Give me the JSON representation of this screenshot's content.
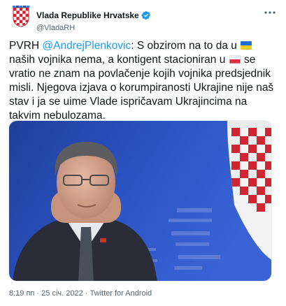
{
  "account": {
    "display_name": "Vlada Republike Hrvatske",
    "handle": "@VladaRH",
    "verified": true,
    "avatar_icon": "croatian-coat-of-arms-icon"
  },
  "tweet": {
    "text_before_mention": "PVRH ",
    "mention": "@AndrejPlenkovic",
    "text_1": ": S obzirom na to da u ",
    "text_2": " naših vojnika nema, a kontigent stacioniran u ",
    "text_3": " se vratio ne znam na povlačenje kojih vojnika predsjednik misli. Njegova izjava o korumpiranosti Ukrajine nije naš stav i ja se uime Vlade ispričavam Ukrajincima na takvim nebulozama.",
    "flag_1": "ukraine-flag-icon",
    "flag_2": "poland-flag-icon"
  },
  "meta": {
    "time": "8:19 пп",
    "date": "25 січ. 2022",
    "source": "Twitter for Android",
    "separator": " · "
  },
  "colors": {
    "link": "#1d9bf0",
    "verified": "#1d9bf0",
    "secondary_text": "#536471"
  }
}
